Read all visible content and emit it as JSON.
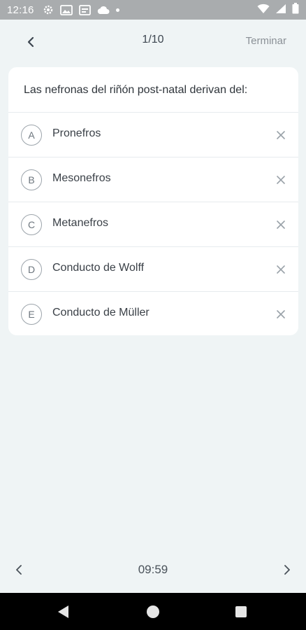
{
  "status_bar": {
    "time": "12:16",
    "left_icons": [
      "settings-icon",
      "image-icon",
      "card-icon",
      "cloud-icon",
      "dot-icon"
    ],
    "right_icons": [
      "wifi-icon",
      "signal-icon",
      "battery-icon"
    ]
  },
  "header": {
    "back_icon": "chevron-left-icon",
    "progress": "1/10",
    "finish_label": "Terminar"
  },
  "question": {
    "text": "Las nefronas del riñón post-natal derivan del:",
    "options": [
      {
        "letter": "A",
        "label": "Pronefros"
      },
      {
        "letter": "B",
        "label": "Mesonefros"
      },
      {
        "letter": "C",
        "label": "Metanefros"
      },
      {
        "letter": "D",
        "label": "Conducto de Wolff"
      },
      {
        "letter": "E",
        "label": "Conducto de Müller"
      }
    ]
  },
  "footer": {
    "timer": "09:59",
    "prev_icon": "chevron-left-icon",
    "next_icon": "chevron-right-icon"
  },
  "colors": {
    "background": "#eff4f5",
    "card": "#ffffff",
    "status_bar": "#a9acae"
  }
}
